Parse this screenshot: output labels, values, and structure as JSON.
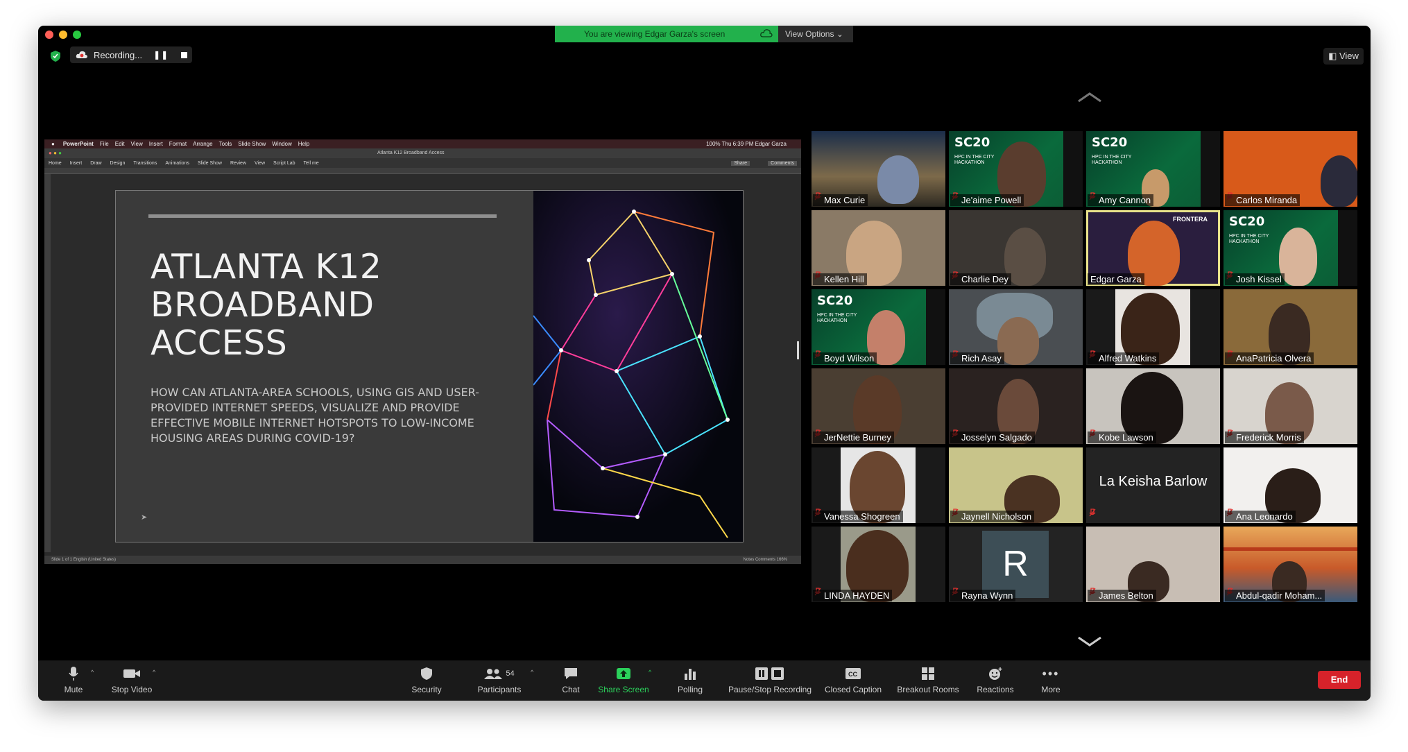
{
  "window": {
    "banner_text": "You are viewing Edgar Garza's screen",
    "view_options": "View Options ⌄",
    "recording_label": "Recording...",
    "view_button": "View"
  },
  "ppt": {
    "menubar": [
      "PowerPoint",
      "File",
      "Edit",
      "View",
      "Insert",
      "Format",
      "Arrange",
      "Tools",
      "Slide Show",
      "Window",
      "Help"
    ],
    "menubar_right": "100%  Thu 6:39 PM   Edgar Garza",
    "doc_title": "Atlanta K12 Broadband Access",
    "ribbon_tabs": [
      "Home",
      "Insert",
      "Draw",
      "Design",
      "Transitions",
      "Animations",
      "Slide Show",
      "Review",
      "View",
      "Script Lab",
      "Tell me"
    ],
    "share": "Share",
    "comments": "Comments",
    "status_left": "Slide 1 of 1     English (United States)",
    "status_right": "Notes   Comments        166%"
  },
  "slide": {
    "title": "ATLANTA K12 BROADBAND ACCESS",
    "subtitle": "HOW CAN ATLANTA-AREA SCHOOLS, USING GIS AND USER-PROVIDED INTERNET SPEEDS, VISUALIZE AND PROVIDE EFFECTIVE MOBILE INTERNET HOTSPOTS TO LOW-INCOME HOUSING AREAS DURING COVID-19?"
  },
  "participants": [
    {
      "name": "Max Curie"
    },
    {
      "name": "Je'aime Powell"
    },
    {
      "name": "Amy Cannon"
    },
    {
      "name": "Carlos Miranda"
    },
    {
      "name": "Kellen Hill"
    },
    {
      "name": "Charlie Dey"
    },
    {
      "name": "Edgar Garza"
    },
    {
      "name": "Josh Kissel"
    },
    {
      "name": "Boyd Wilson"
    },
    {
      "name": "Rich Asay"
    },
    {
      "name": "Alfred Watkins"
    },
    {
      "name": "AnaPatricia Olvera"
    },
    {
      "name": "JerNettie Burney"
    },
    {
      "name": "Josselyn Salgado"
    },
    {
      "name": "Kobe Lawson"
    },
    {
      "name": "Frederick Morris"
    },
    {
      "name": "Vanessa Shogreen"
    },
    {
      "name": "Jaynell Nicholson"
    },
    {
      "name": "La Keisha Barlow"
    },
    {
      "name": "Ana Leonardo"
    },
    {
      "name": "LINDA HAYDEN"
    },
    {
      "name": "Rayna Wynn"
    },
    {
      "name": "James Belton"
    },
    {
      "name": "Abdul-qadir Moham..."
    }
  ],
  "big_name": "La Keisha Barlow",
  "avatar_letter": "R",
  "sc20": {
    "logo": "SC20",
    "hpc": "HPC IN THE CITY HACKATHON"
  },
  "frontera": "FRONTERA",
  "toolbar": {
    "mute": "Mute",
    "stop_video": "Stop Video",
    "security": "Security",
    "participants": "Participants",
    "participant_count": "54",
    "chat": "Chat",
    "share_screen": "Share Screen",
    "polling": "Polling",
    "pause_stop": "Pause/Stop Recording",
    "closed_caption": "Closed Caption",
    "breakout": "Breakout Rooms",
    "reactions": "Reactions",
    "more": "More",
    "end": "End"
  },
  "colors": {
    "banner_green": "#22b14c",
    "active_speaker": "#e8e28a",
    "end_red": "#d6222a",
    "share_green": "#2bd15b"
  }
}
